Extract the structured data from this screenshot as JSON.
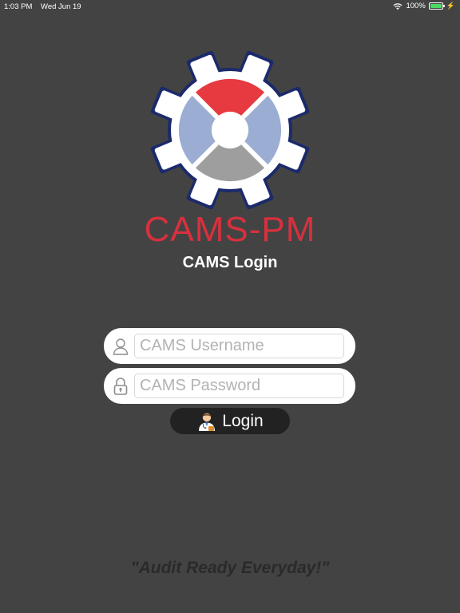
{
  "status_bar": {
    "time": "1:03 PM",
    "date": "Wed Jun 19",
    "battery_text": "100%",
    "battery_level": 1.0,
    "icons": [
      "wifi-icon",
      "battery-icon",
      "charging-bolt-icon"
    ]
  },
  "brand": {
    "name": "CAMS-PM",
    "logo_icon": "gear-logo-icon",
    "colors": {
      "gear": "#ffffff",
      "gear_outline": "#1b2a6b",
      "top_segment": "#e63a40",
      "side_segments": "#9cadd3",
      "bottom_segment": "#9e9e9e",
      "text": "#d8303e"
    }
  },
  "page": {
    "title": "CAMS Login",
    "tagline": "\"Audit Ready Everyday!\""
  },
  "form": {
    "username": {
      "value": "",
      "placeholder": "CAMS Username",
      "icon": "user-icon"
    },
    "password": {
      "value": "",
      "placeholder": "CAMS Password",
      "icon": "lock-icon"
    },
    "login_button": {
      "label": "Login",
      "icon": "doctor-icon"
    }
  },
  "theme": {
    "background": "#434343",
    "button_background": "#222222"
  }
}
